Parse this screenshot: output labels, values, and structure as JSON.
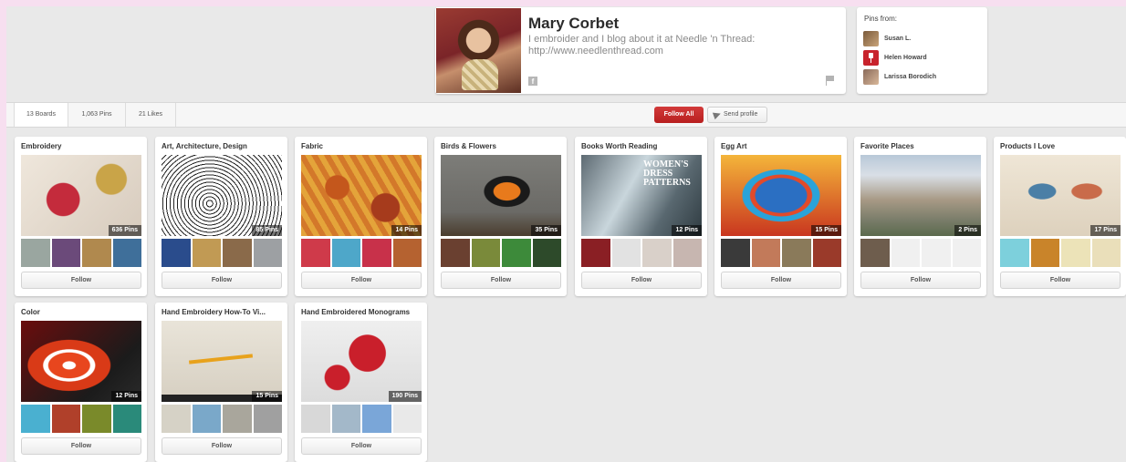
{
  "profile": {
    "name": "Mary Corbet",
    "bio": "I embroider and I blog about it at Needle 'n Thread: http://www.needlenthread.com",
    "facebook_glyph": "f"
  },
  "pins_from": {
    "title": "Pins from:",
    "items": [
      {
        "name": "Susan L."
      },
      {
        "name": "Helen Howard"
      },
      {
        "name": "Larissa Borodich"
      }
    ]
  },
  "nav": {
    "tabs": [
      {
        "label": "13 Boards"
      },
      {
        "label": "1,063 Pins"
      },
      {
        "label": "21 Likes"
      }
    ],
    "follow_all": "Follow All",
    "send_profile": "Send profile"
  },
  "boards": [
    {
      "title": "Embroidery",
      "pins": "636 Pins",
      "follow": "Follow"
    },
    {
      "title": "Art, Architecture, Design",
      "pins": "85 Pins",
      "follow": "Follow"
    },
    {
      "title": "Fabric",
      "pins": "14 Pins",
      "follow": "Follow"
    },
    {
      "title": "Birds & Flowers",
      "pins": "35 Pins",
      "follow": "Follow"
    },
    {
      "title": "Books Worth Reading",
      "pins": "12 Pins",
      "follow": "Follow",
      "cover_text": "WOMEN'S DRESS PATTERNS"
    },
    {
      "title": "Egg Art",
      "pins": "15 Pins",
      "follow": "Follow"
    },
    {
      "title": "Favorite Places",
      "pins": "2 Pins",
      "follow": "Follow"
    },
    {
      "title": "Products I Love",
      "pins": "17 Pins",
      "follow": "Follow"
    },
    {
      "title": "Color",
      "pins": "12 Pins",
      "follow": "Follow"
    },
    {
      "title": "Hand Embroidery How-To Vi...",
      "pins": "15 Pins",
      "follow": "Follow"
    },
    {
      "title": "Hand Embroidered Monograms",
      "pins": "190 Pins",
      "follow": "Follow"
    }
  ]
}
